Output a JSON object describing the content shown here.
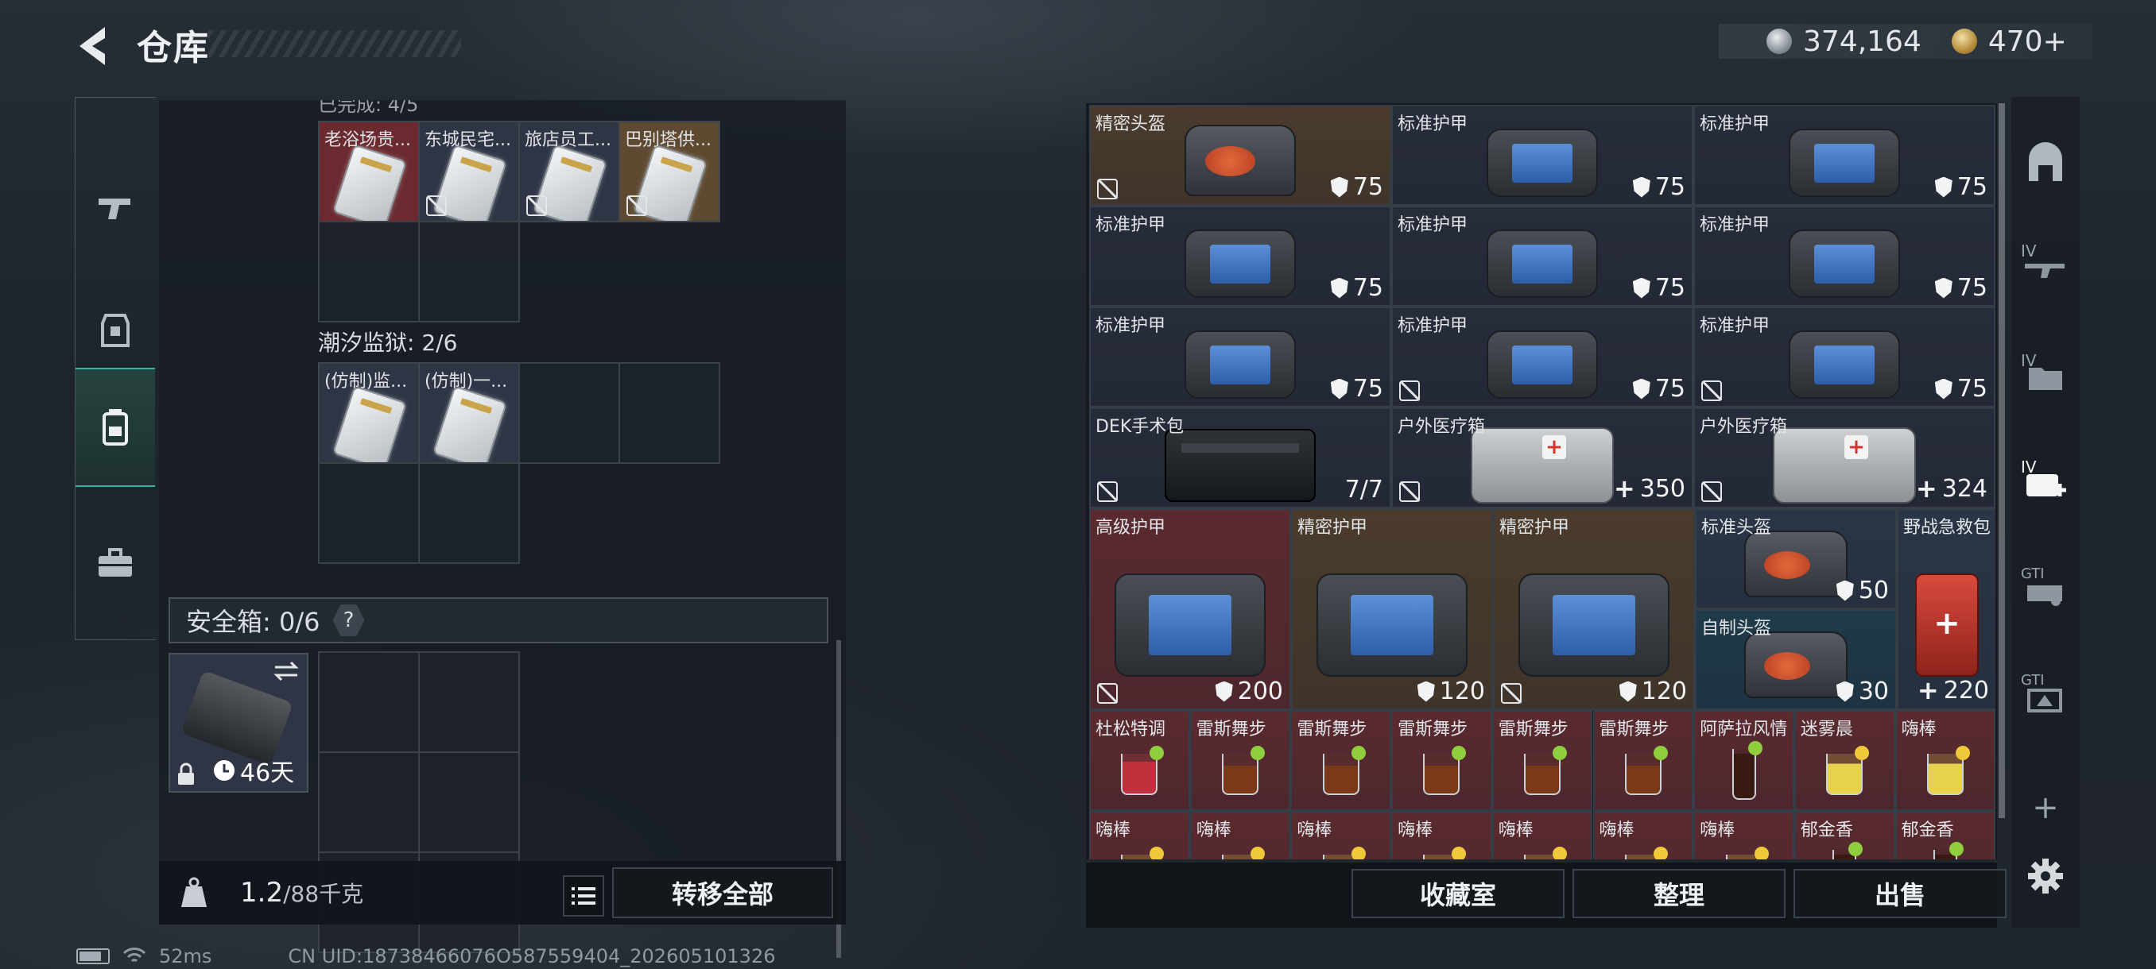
{
  "header": {
    "title": "仓库",
    "currency1": "374,164",
    "currency2": "470+"
  },
  "left_panel": {
    "cutoff_label": "已完成: 4/5",
    "keycards_row": [
      {
        "name": "老浴场贵...",
        "bg": "#6b2a2f",
        "no_bind": false
      },
      {
        "name": "东城民宅...",
        "bg": "#2f3545",
        "no_bind": true
      },
      {
        "name": "旅店员工...",
        "bg": "#2f3545",
        "no_bind": true
      },
      {
        "name": "巴别塔供...",
        "bg": "#5e4a31",
        "no_bind": true
      }
    ],
    "prison_title": "潮汐监狱: 2/6",
    "prison_cards": [
      {
        "name": "(仿制)监...",
        "bg": "#2f3545"
      },
      {
        "name": "(仿制)一...",
        "bg": "#2f3545"
      }
    ],
    "safebox_label": "安全箱: 0/6",
    "help_label": "?",
    "safebox_days": "46天",
    "weight_value": "1.2",
    "weight_cap": "/88千克",
    "transfer_all": "转移全部"
  },
  "grid_items": [
    {
      "name": "精密头盔",
      "type": "helmet",
      "value": "75",
      "vicon": "shield",
      "bg": "#4a3b2c",
      "no_bind": true
    },
    {
      "name": "标准护甲",
      "type": "armor",
      "value": "75",
      "vicon": "shield",
      "bg": "#272c3b",
      "no_bind": false
    },
    {
      "name": "标准护甲",
      "type": "armor",
      "value": "75",
      "vicon": "shield",
      "bg": "#272c3b",
      "no_bind": false
    },
    {
      "name": "标准护甲",
      "type": "armor",
      "value": "75",
      "vicon": "shield",
      "bg": "#272c3b",
      "no_bind": false
    },
    {
      "name": "标准护甲",
      "type": "armor",
      "value": "75",
      "vicon": "shield",
      "bg": "#272c3b",
      "no_bind": false
    },
    {
      "name": "标准护甲",
      "type": "armor",
      "value": "75",
      "vicon": "shield",
      "bg": "#272c3b",
      "no_bind": false
    },
    {
      "name": "标准护甲",
      "type": "armor",
      "value": "75",
      "vicon": "shield",
      "bg": "#272c3b",
      "no_bind": false
    },
    {
      "name": "标准护甲",
      "type": "armor",
      "value": "75",
      "vicon": "shield",
      "bg": "#272c3b",
      "no_bind": true
    },
    {
      "name": "标准护甲",
      "type": "armor",
      "value": "75",
      "vicon": "shield",
      "bg": "#272c3b",
      "no_bind": true
    },
    {
      "name": "DEK手术包",
      "type": "kit",
      "value": "7/7",
      "vicon": "",
      "bg": "#272c3b",
      "no_bind": true
    },
    {
      "name": "户外医疗箱",
      "type": "medbag",
      "value": "350",
      "vicon": "plus",
      "bg": "#272c3b",
      "no_bind": true
    },
    {
      "name": "户外医疗箱",
      "type": "medbag",
      "value": "324",
      "vicon": "plus",
      "bg": "#272c3b",
      "no_bind": true
    },
    {
      "name": "高级护甲",
      "type": "armor",
      "value": "200",
      "vicon": "shield",
      "bg": "#5a2a30",
      "no_bind": true
    },
    {
      "name": "精密护甲",
      "type": "armor",
      "value": "120",
      "vicon": "shield",
      "bg": "#4a3b2c",
      "no_bind": false
    },
    {
      "name": "精密护甲",
      "type": "armor",
      "value": "120",
      "vicon": "shield",
      "bg": "#4a3b2c",
      "no_bind": true
    },
    {
      "name": "标准头盔",
      "type": "helmet",
      "value": "50",
      "vicon": "shield",
      "bg": "#2a3546",
      "no_bind": false
    },
    {
      "name": "野战急救包",
      "type": "redkit",
      "value": "220",
      "vicon": "plus",
      "bg": "#2a3546",
      "no_bind": false
    },
    {
      "name": "自制头盔",
      "type": "helmet",
      "value": "30",
      "vicon": "shield",
      "bg": "#1f3a4a",
      "no_bind": false
    },
    {
      "name": "杜松特调",
      "type": "drink-red",
      "value": "",
      "vicon": "",
      "bg": "#5a2a30",
      "no_bind": false
    },
    {
      "name": "雷斯舞步",
      "type": "drink-brown",
      "value": "",
      "vicon": "",
      "bg": "#5a2a30",
      "no_bind": false
    },
    {
      "name": "雷斯舞步",
      "type": "drink-brown",
      "value": "",
      "vicon": "",
      "bg": "#5a2a30",
      "no_bind": false
    },
    {
      "name": "雷斯舞步",
      "type": "drink-brown",
      "value": "",
      "vicon": "",
      "bg": "#5a2a30",
      "no_bind": false
    },
    {
      "name": "雷斯舞步",
      "type": "drink-brown",
      "value": "",
      "vicon": "",
      "bg": "#5a2a30",
      "no_bind": false
    },
    {
      "name": "雷斯舞步",
      "type": "drink-brown",
      "value": "",
      "vicon": "",
      "bg": "#5a2a30",
      "no_bind": false
    },
    {
      "name": "阿萨拉风情",
      "type": "drink-dark",
      "value": "",
      "vicon": "",
      "bg": "#5a2a30",
      "no_bind": false
    },
    {
      "name": "迷雾晨",
      "type": "drink-yellow",
      "value": "",
      "vicon": "",
      "bg": "#5a2a30",
      "no_bind": false
    },
    {
      "name": "嗨棒",
      "type": "drink-yellow",
      "value": "",
      "vicon": "",
      "bg": "#5a2a30",
      "no_bind": false
    },
    {
      "name": "嗨棒",
      "type": "drink-yellow",
      "value": "",
      "vicon": "",
      "bg": "#5a2a30",
      "no_bind": false
    },
    {
      "name": "嗨棒",
      "type": "drink-yellow",
      "value": "",
      "vicon": "",
      "bg": "#5a2a30",
      "no_bind": false
    },
    {
      "name": "嗨棒",
      "type": "drink-yellow",
      "value": "",
      "vicon": "",
      "bg": "#5a2a30",
      "no_bind": false
    },
    {
      "name": "嗨棒",
      "type": "drink-yellow",
      "value": "",
      "vicon": "",
      "bg": "#5a2a30",
      "no_bind": false
    },
    {
      "name": "嗨棒",
      "type": "drink-yellow",
      "value": "",
      "vicon": "",
      "bg": "#5a2a30",
      "no_bind": false
    },
    {
      "name": "嗨棒",
      "type": "drink-yellow",
      "value": "",
      "vicon": "",
      "bg": "#5a2a30",
      "no_bind": false
    },
    {
      "name": "嗨棒",
      "type": "drink-yellow",
      "value": "",
      "vicon": "",
      "bg": "#5a2a30",
      "no_bind": false
    },
    {
      "name": "郁金香",
      "type": "drink-dark",
      "value": "",
      "vicon": "",
      "bg": "#5a2a30",
      "no_bind": false
    },
    {
      "name": "郁金香",
      "type": "drink-dark",
      "value": "",
      "vicon": "",
      "bg": "#5a2a30",
      "no_bind": false
    }
  ],
  "bottom_buttons": {
    "collection": "收藏室",
    "organize": "整理",
    "sell": "出售"
  },
  "side_tabs": [
    "IV",
    "IV",
    "IV",
    "GTI",
    "GTI"
  ],
  "status": {
    "ping": "52ms",
    "uid": "CN UID:18738466076O587559404_202605101326"
  }
}
